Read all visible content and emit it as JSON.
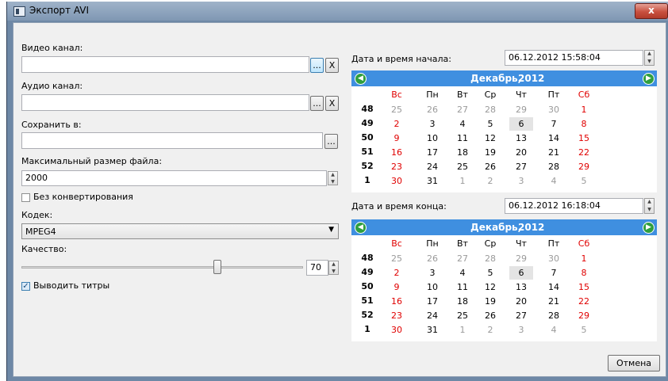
{
  "window": {
    "title": "Экспорт AVI",
    "close_label": "x"
  },
  "left": {
    "video_label": "Видео канал:",
    "video_value": "",
    "audio_label": "Аудио канал:",
    "audio_value": "",
    "save_label": "Сохранить в:",
    "save_value": "",
    "browse_label": "...",
    "clear_label": "X",
    "maxsize_label": "Максимальный размер файла:",
    "maxsize_value": "2000",
    "noconvert_label": "Без конвертирования",
    "noconvert_checked": false,
    "codec_label": "Кодек:",
    "codec_value": "MPEG4",
    "quality_label": "Качество:",
    "quality_value": "70",
    "quality_fraction": 0.7,
    "subtitles_label": "Выводить титры",
    "subtitles_checked": true
  },
  "start": {
    "label": "Дата и время начала:",
    "datetime": "06.12.2012 15:58:04",
    "month": "Декабрь,",
    "year": "2012"
  },
  "end": {
    "label": "Дата и время конца:",
    "datetime": "06.12.2012 16:18:04",
    "month": "Декабрь,",
    "year": "2012"
  },
  "calendar": {
    "days": [
      "Вс",
      "Пн",
      "Вт",
      "Ср",
      "Чт",
      "Пт",
      "Сб"
    ],
    "weeks": [
      {
        "num": "48",
        "days": [
          "25",
          "26",
          "27",
          "28",
          "29",
          "30",
          "1"
        ]
      },
      {
        "num": "49",
        "days": [
          "2",
          "3",
          "4",
          "5",
          "6",
          "7",
          "8"
        ]
      },
      {
        "num": "50",
        "days": [
          "9",
          "10",
          "11",
          "12",
          "13",
          "14",
          "15"
        ]
      },
      {
        "num": "51",
        "days": [
          "16",
          "17",
          "18",
          "19",
          "20",
          "21",
          "22"
        ]
      },
      {
        "num": "52",
        "days": [
          "23",
          "24",
          "25",
          "26",
          "27",
          "28",
          "29"
        ]
      },
      {
        "num": "1",
        "days": [
          "30",
          "31",
          "1",
          "2",
          "3",
          "4",
          "5"
        ]
      }
    ],
    "selected": "6"
  },
  "buttons": {
    "cancel": "Отмена"
  },
  "colors": {
    "calendar_header": "#3f8fe0",
    "weekend": "#e00000",
    "nav_arrow": "#2f9f3f"
  }
}
